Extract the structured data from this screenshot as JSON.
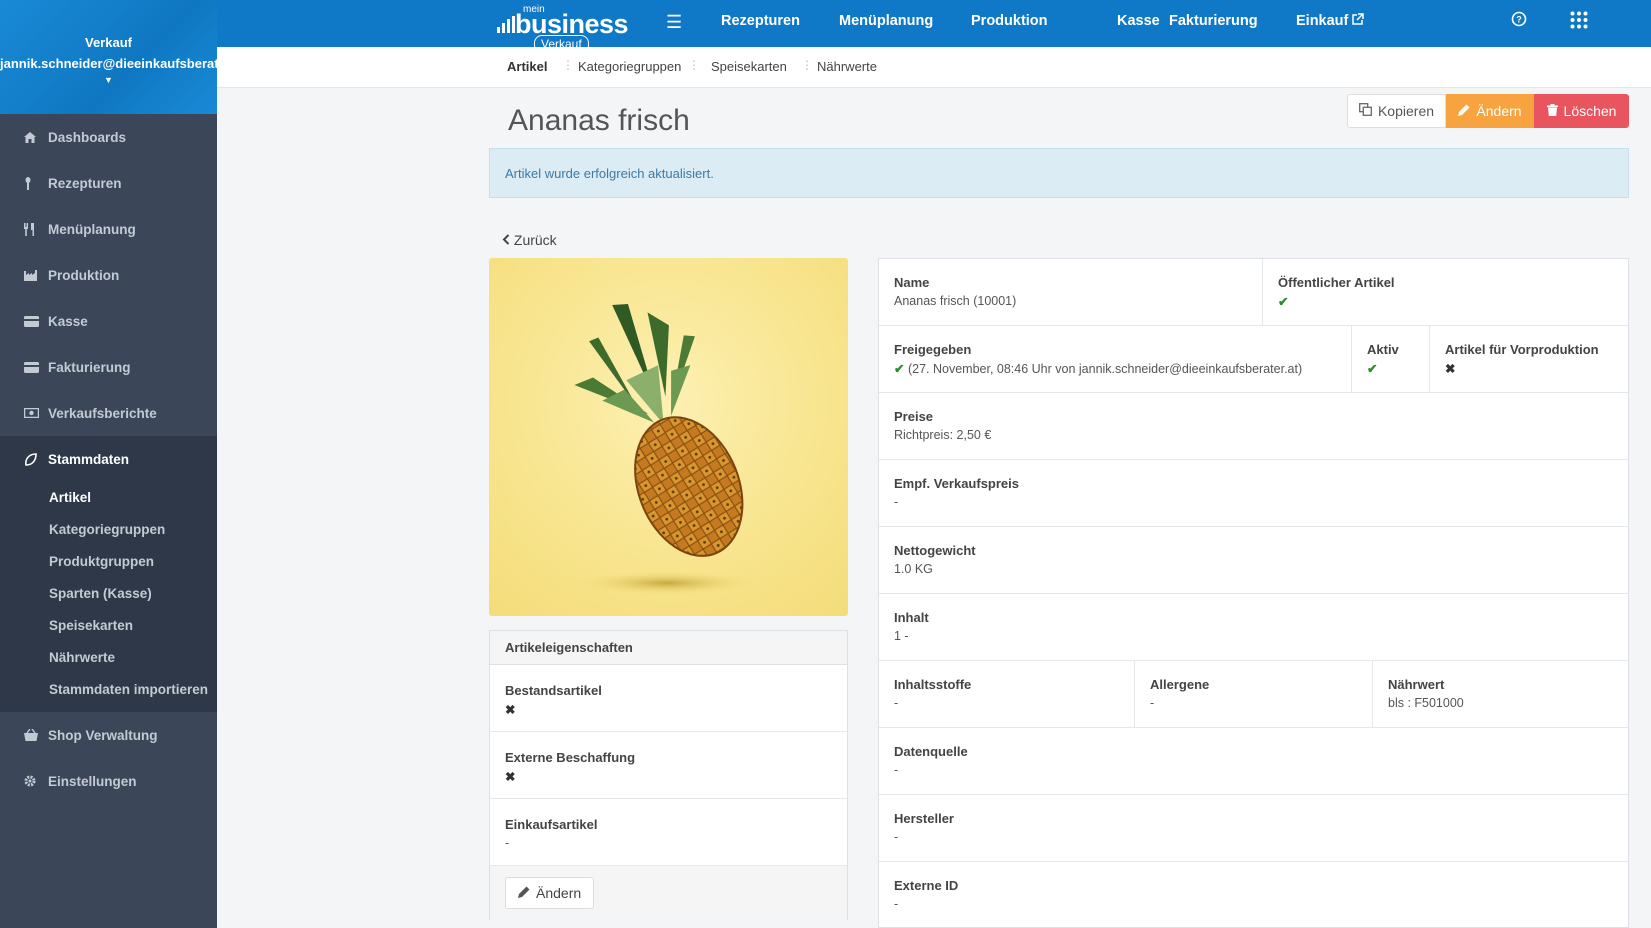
{
  "sidebar": {
    "user": {
      "role": "Verkauf",
      "email": "jannik.schneider@dieeinkaufsberater.at"
    },
    "items": [
      {
        "label": "Dashboards",
        "icon": "home-icon"
      },
      {
        "label": "Rezepturen",
        "icon": "spoon-icon"
      },
      {
        "label": "Menüplanung",
        "icon": "cutlery-icon"
      },
      {
        "label": "Produktion",
        "icon": "factory-icon"
      },
      {
        "label": "Kasse",
        "icon": "card-icon"
      },
      {
        "label": "Fakturierung",
        "icon": "card-icon"
      },
      {
        "label": "Verkaufsberichte",
        "icon": "money-icon"
      },
      {
        "label": "Stammdaten",
        "icon": "leaf-icon"
      },
      {
        "label": "Shop Verwaltung",
        "icon": "basket-icon"
      },
      {
        "label": "Einstellungen",
        "icon": "gear-icon"
      }
    ],
    "sub_items": [
      {
        "label": "Artikel"
      },
      {
        "label": "Kategoriegruppen"
      },
      {
        "label": "Produktgruppen"
      },
      {
        "label": "Sparten (Kasse)"
      },
      {
        "label": "Speisekarten"
      },
      {
        "label": "Nährwerte"
      },
      {
        "label": "Stammdaten importieren"
      }
    ]
  },
  "topbar": {
    "logo": {
      "mein": "mein",
      "brand": "business",
      "sub": "Verkauf"
    },
    "nav": [
      "Rezepturen",
      "Menüplanung",
      "Produktion",
      "Kasse",
      "Fakturierung",
      "Einkauf"
    ]
  },
  "subnav": {
    "tabs": [
      "Artikel",
      "Kategoriegruppen",
      "Speisekarten",
      "Nährwerte"
    ]
  },
  "page": {
    "title": "Ananas frisch",
    "actions": {
      "copy": "Kopieren",
      "edit": "Ändern",
      "delete": "Löschen"
    },
    "alert": "Artikel wurde erfolgreich aktualisiert.",
    "back": "Zurück"
  },
  "properties": {
    "title": "Artikeleigenschaften",
    "rows": [
      {
        "label": "Bestandsartikel",
        "value": "✖"
      },
      {
        "label": "Externe Beschaffung",
        "value": "✖"
      },
      {
        "label": "Einkaufsartikel",
        "value": "-"
      }
    ],
    "edit_label": "Ändern"
  },
  "details": {
    "name_label": "Name",
    "name_value": "Ananas frisch (10001)",
    "public_label": "Öffentlicher Artikel",
    "public_value": "✔",
    "released_label": "Freigegeben",
    "released_check": "✔",
    "released_value": "(27. November, 08:46 Uhr von jannik.schneider@dieeinkaufsberater.at)",
    "active_label": "Aktiv",
    "active_value": "✔",
    "preprod_label": "Artikel für Vorproduktion",
    "preprod_value": "✖",
    "prices_label": "Preise",
    "prices_value": "Richtpreis: 2,50 €",
    "rec_price_label": "Empf. Verkaufspreis",
    "rec_price_value": "-",
    "net_weight_label": "Nettogewicht",
    "net_weight_value": "1.0 KG",
    "content_label": "Inhalt",
    "content_value": "1 -",
    "ingredients_label": "Inhaltsstoffe",
    "ingredients_value": "-",
    "allergens_label": "Allergene",
    "allergens_value": "-",
    "nutrition_label": "Nährwert",
    "nutrition_value": "bls : F501000",
    "source_label": "Datenquelle",
    "source_value": "-",
    "manufacturer_label": "Hersteller",
    "manufacturer_value": "-",
    "external_id_label": "Externe ID",
    "external_id_value": "-"
  }
}
